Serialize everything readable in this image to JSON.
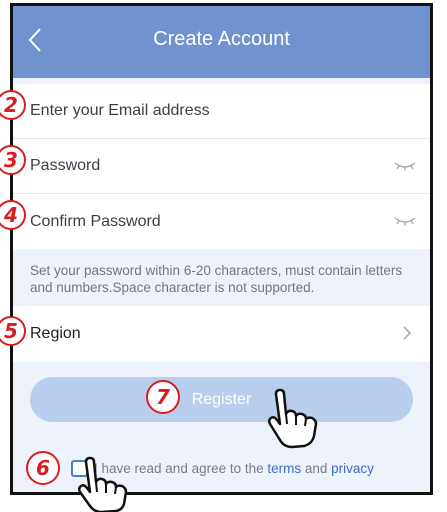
{
  "header": {
    "title": "Create Account"
  },
  "form": {
    "email_placeholder": "Enter your Email address",
    "password_placeholder": "Password",
    "confirm_placeholder": "Confirm Password",
    "hint": "Set your password within 6-20 characters, must contain letters and numbers.Space character is not supported.",
    "region_label": "Region",
    "register_label": "Register"
  },
  "agreement": {
    "prefix": "I have read and agree to the ",
    "terms": "terms",
    "middle": " and ",
    "privacy": "privacy"
  },
  "annotations": {
    "step2": "2",
    "step3": "3",
    "step4": "4",
    "step5": "5",
    "step6": "6",
    "step7": "7"
  },
  "colors": {
    "header": "#6f93cf",
    "register_button": "#b9cdec",
    "link": "#3f6fc7",
    "annotation": "#d81e1e"
  },
  "icons": {
    "back": "chevron-left-icon",
    "eye": "eye-closed-icon",
    "region": "chevron-right-icon",
    "pointer": "hand-pointer-icon"
  }
}
